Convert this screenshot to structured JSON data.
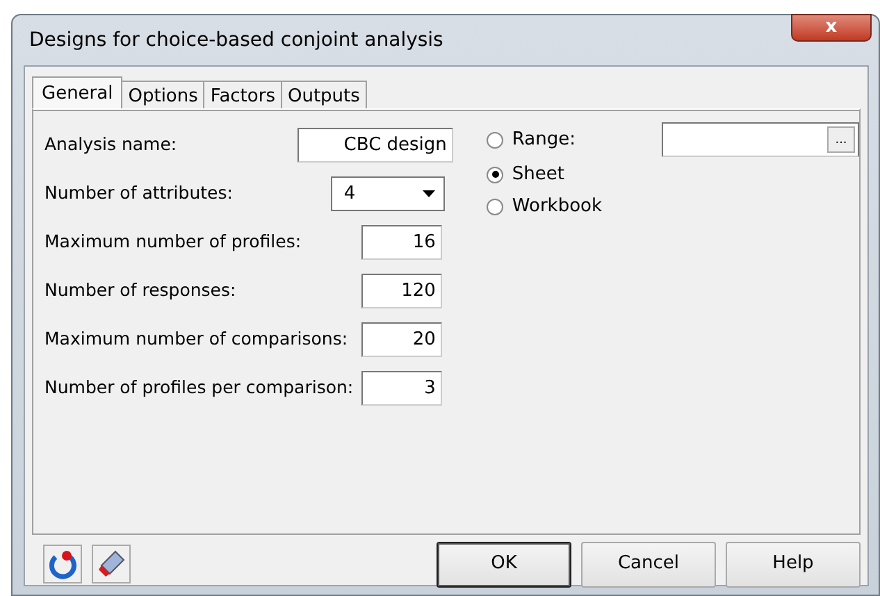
{
  "window": {
    "title": "Designs for choice-based conjoint analysis",
    "close": "x"
  },
  "tabs": [
    {
      "label": "General",
      "selected": true
    },
    {
      "label": "Options",
      "selected": false
    },
    {
      "label": "Factors",
      "selected": false
    },
    {
      "label": "Outputs",
      "selected": false
    }
  ],
  "fields": [
    {
      "label": "Analysis name:",
      "value": "CBC design",
      "kind": "text"
    },
    {
      "label": "Number of attributes:",
      "value": "4",
      "kind": "select"
    },
    {
      "label": "Maximum number of profiles:",
      "value": "16",
      "kind": "number"
    },
    {
      "label": "Number of responses:",
      "value": "120",
      "kind": "number"
    },
    {
      "label": "Maximum number of comparisons:",
      "value": "20",
      "kind": "number"
    },
    {
      "label": "Number of profiles per comparison:",
      "value": "3",
      "kind": "number"
    }
  ],
  "destination": [
    {
      "label": "Range:",
      "selected": false
    },
    {
      "label": "Sheet",
      "selected": true
    },
    {
      "label": "Workbook",
      "selected": false
    }
  ],
  "range_button": "...",
  "buttons": [
    {
      "label": "OK",
      "default": true
    },
    {
      "label": "Cancel",
      "default": false
    },
    {
      "label": "Help",
      "default": false
    }
  ]
}
